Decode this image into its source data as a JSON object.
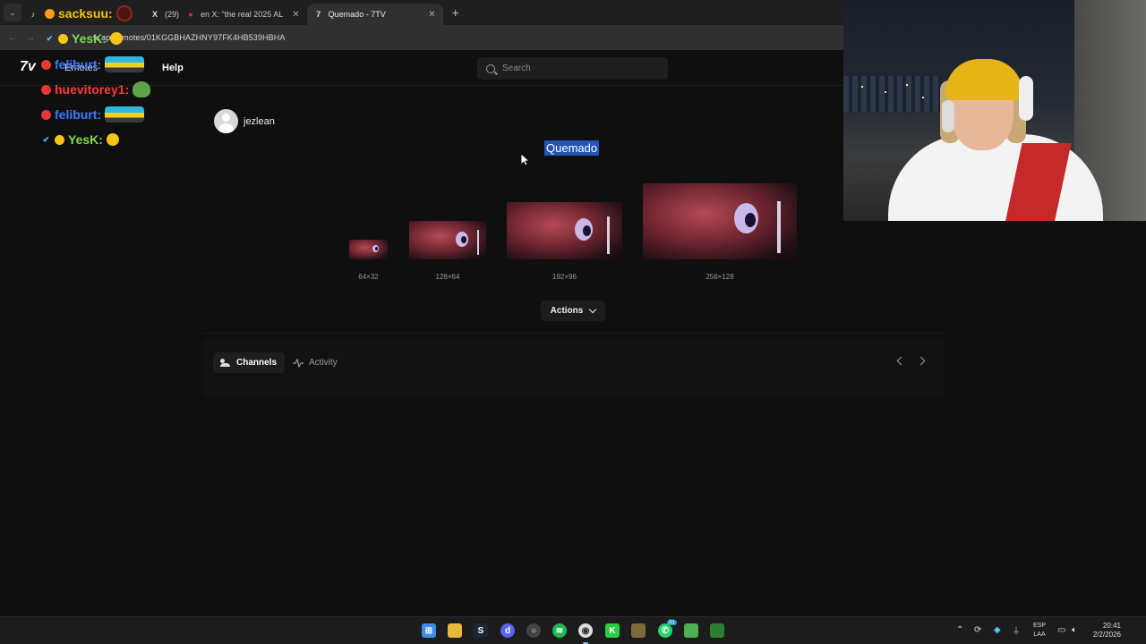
{
  "browser": {
    "tabs": [
      {
        "label": "",
        "favicon": "tiktok-icon",
        "active": false
      },
      {
        "label": "(29)",
        "favicon": "x-icon",
        "active": false
      },
      {
        "label": "en X: \"the real 2025 AL",
        "favicon": "pin-icon",
        "active": false
      },
      {
        "label": "Quemado - 7TV",
        "favicon": "7tv-icon",
        "active": true
      }
    ],
    "url": "tv.app/emotes/01KGGBHAZHNY97FK4HB539HBHA"
  },
  "site": {
    "logo": "7v",
    "nav": {
      "emotes": "Emotes",
      "help": "Help"
    },
    "search": {
      "placeholder": "Search"
    }
  },
  "chat": [
    {
      "user": "sacksuu:",
      "color": "#f2c200",
      "emote": "round"
    },
    {
      "user": "YesK:",
      "color": "#7ed957",
      "emote": "face"
    },
    {
      "user": "feliburt:",
      "color": "#3f7bff",
      "emote": "car"
    },
    {
      "user": "huevitorey1:",
      "color": "#ff3b3b",
      "emote": "frog"
    },
    {
      "user": "feliburt:",
      "color": "#3f7bff",
      "emote": "car"
    },
    {
      "user": "YesK:",
      "color": "#7ed957",
      "emote": "face"
    }
  ],
  "emote": {
    "author": "jezlean",
    "name": "Quemado",
    "sizes": [
      "64×32",
      "128×64",
      "192×96",
      "256×128"
    ],
    "actions_label": "Actions"
  },
  "tabs": {
    "channels": "Channels",
    "activity": "Activity"
  },
  "taskbar": {
    "lang_top": "ESP",
    "lang_bottom": "LAA",
    "time": "20:41",
    "date": "2/2/2026",
    "whatsapp_badge": "31"
  },
  "colors": {
    "selection": "#2456b3",
    "background": "#0f0f0f"
  }
}
